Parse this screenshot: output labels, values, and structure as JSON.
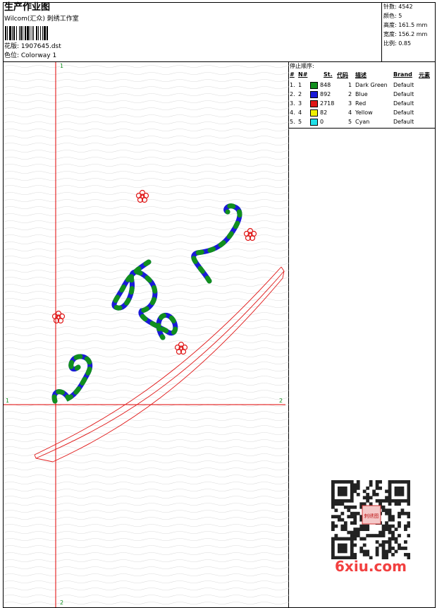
{
  "header": {
    "title": "生产作业图",
    "company": "Wilcom(汇众) 刺绣工作室",
    "design_line": "花版: 1907645.dst",
    "colorway_line": "色位: Colorway 1"
  },
  "stats": [
    {
      "label": "针数",
      "value": "4542"
    },
    {
      "label": "颜色",
      "value": "5"
    },
    {
      "label": "高度",
      "value": "161.5 mm"
    },
    {
      "label": "宽度",
      "value": "156.2 mm"
    },
    {
      "label": "比例",
      "value": "0.85"
    }
  ],
  "stop_sequence": {
    "heading": "停止顺序:",
    "columns": [
      "#",
      "N#",
      "St.",
      "代码",
      "描述",
      "Brand",
      "元素"
    ],
    "rows": [
      {
        "idx": "1.",
        "n": "1",
        "color": "#118f1e",
        "stitches": "848",
        "code": "1",
        "desc": "Dark Green",
        "brand": "Default"
      },
      {
        "idx": "2.",
        "n": "2",
        "color": "#1a1ad8",
        "stitches": "892",
        "code": "2",
        "desc": "Blue",
        "brand": "Default"
      },
      {
        "idx": "3.",
        "n": "3",
        "color": "#e01818",
        "stitches": "2718",
        "code": "3",
        "desc": "Red",
        "brand": "Default"
      },
      {
        "idx": "4.",
        "n": "4",
        "color": "#f0f000",
        "stitches": "82",
        "code": "4",
        "desc": "Yellow",
        "brand": "Default"
      },
      {
        "idx": "5.",
        "n": "5",
        "color": "#20e0e8",
        "stitches": "0",
        "code": "5",
        "desc": "Cyan",
        "brand": "Default"
      }
    ]
  },
  "guides": {
    "top_v": "1",
    "bottom_v": "2",
    "left_h": "1",
    "right_h": "2"
  },
  "watermark": {
    "site": "6xiu.com",
    "stamp": "刺绣图"
  }
}
